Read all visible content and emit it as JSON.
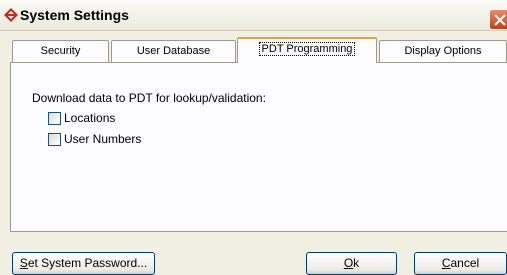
{
  "window": {
    "title": "System Settings"
  },
  "tabs": [
    {
      "label": "Security"
    },
    {
      "label": "User Database"
    },
    {
      "label": "PDT Programming"
    },
    {
      "label": "Display Options"
    }
  ],
  "panel": {
    "description": "Download data to PDT for lookup/validation:",
    "checkboxes": [
      {
        "label": "Locations",
        "checked": false
      },
      {
        "label": "User Numbers",
        "checked": false
      }
    ]
  },
  "buttons": {
    "password": {
      "mnemonic": "S",
      "rest": "et System Password..."
    },
    "ok": {
      "mnemonic": "O",
      "rest": "k"
    },
    "cancel": {
      "mnemonic": "C",
      "rest": "ancel"
    }
  },
  "icons": {
    "app": "app-diamond-icon",
    "close": "close-icon"
  },
  "colors": {
    "accent": "#e3a437",
    "close": "#c2401c",
    "button_border": "#003c74"
  }
}
